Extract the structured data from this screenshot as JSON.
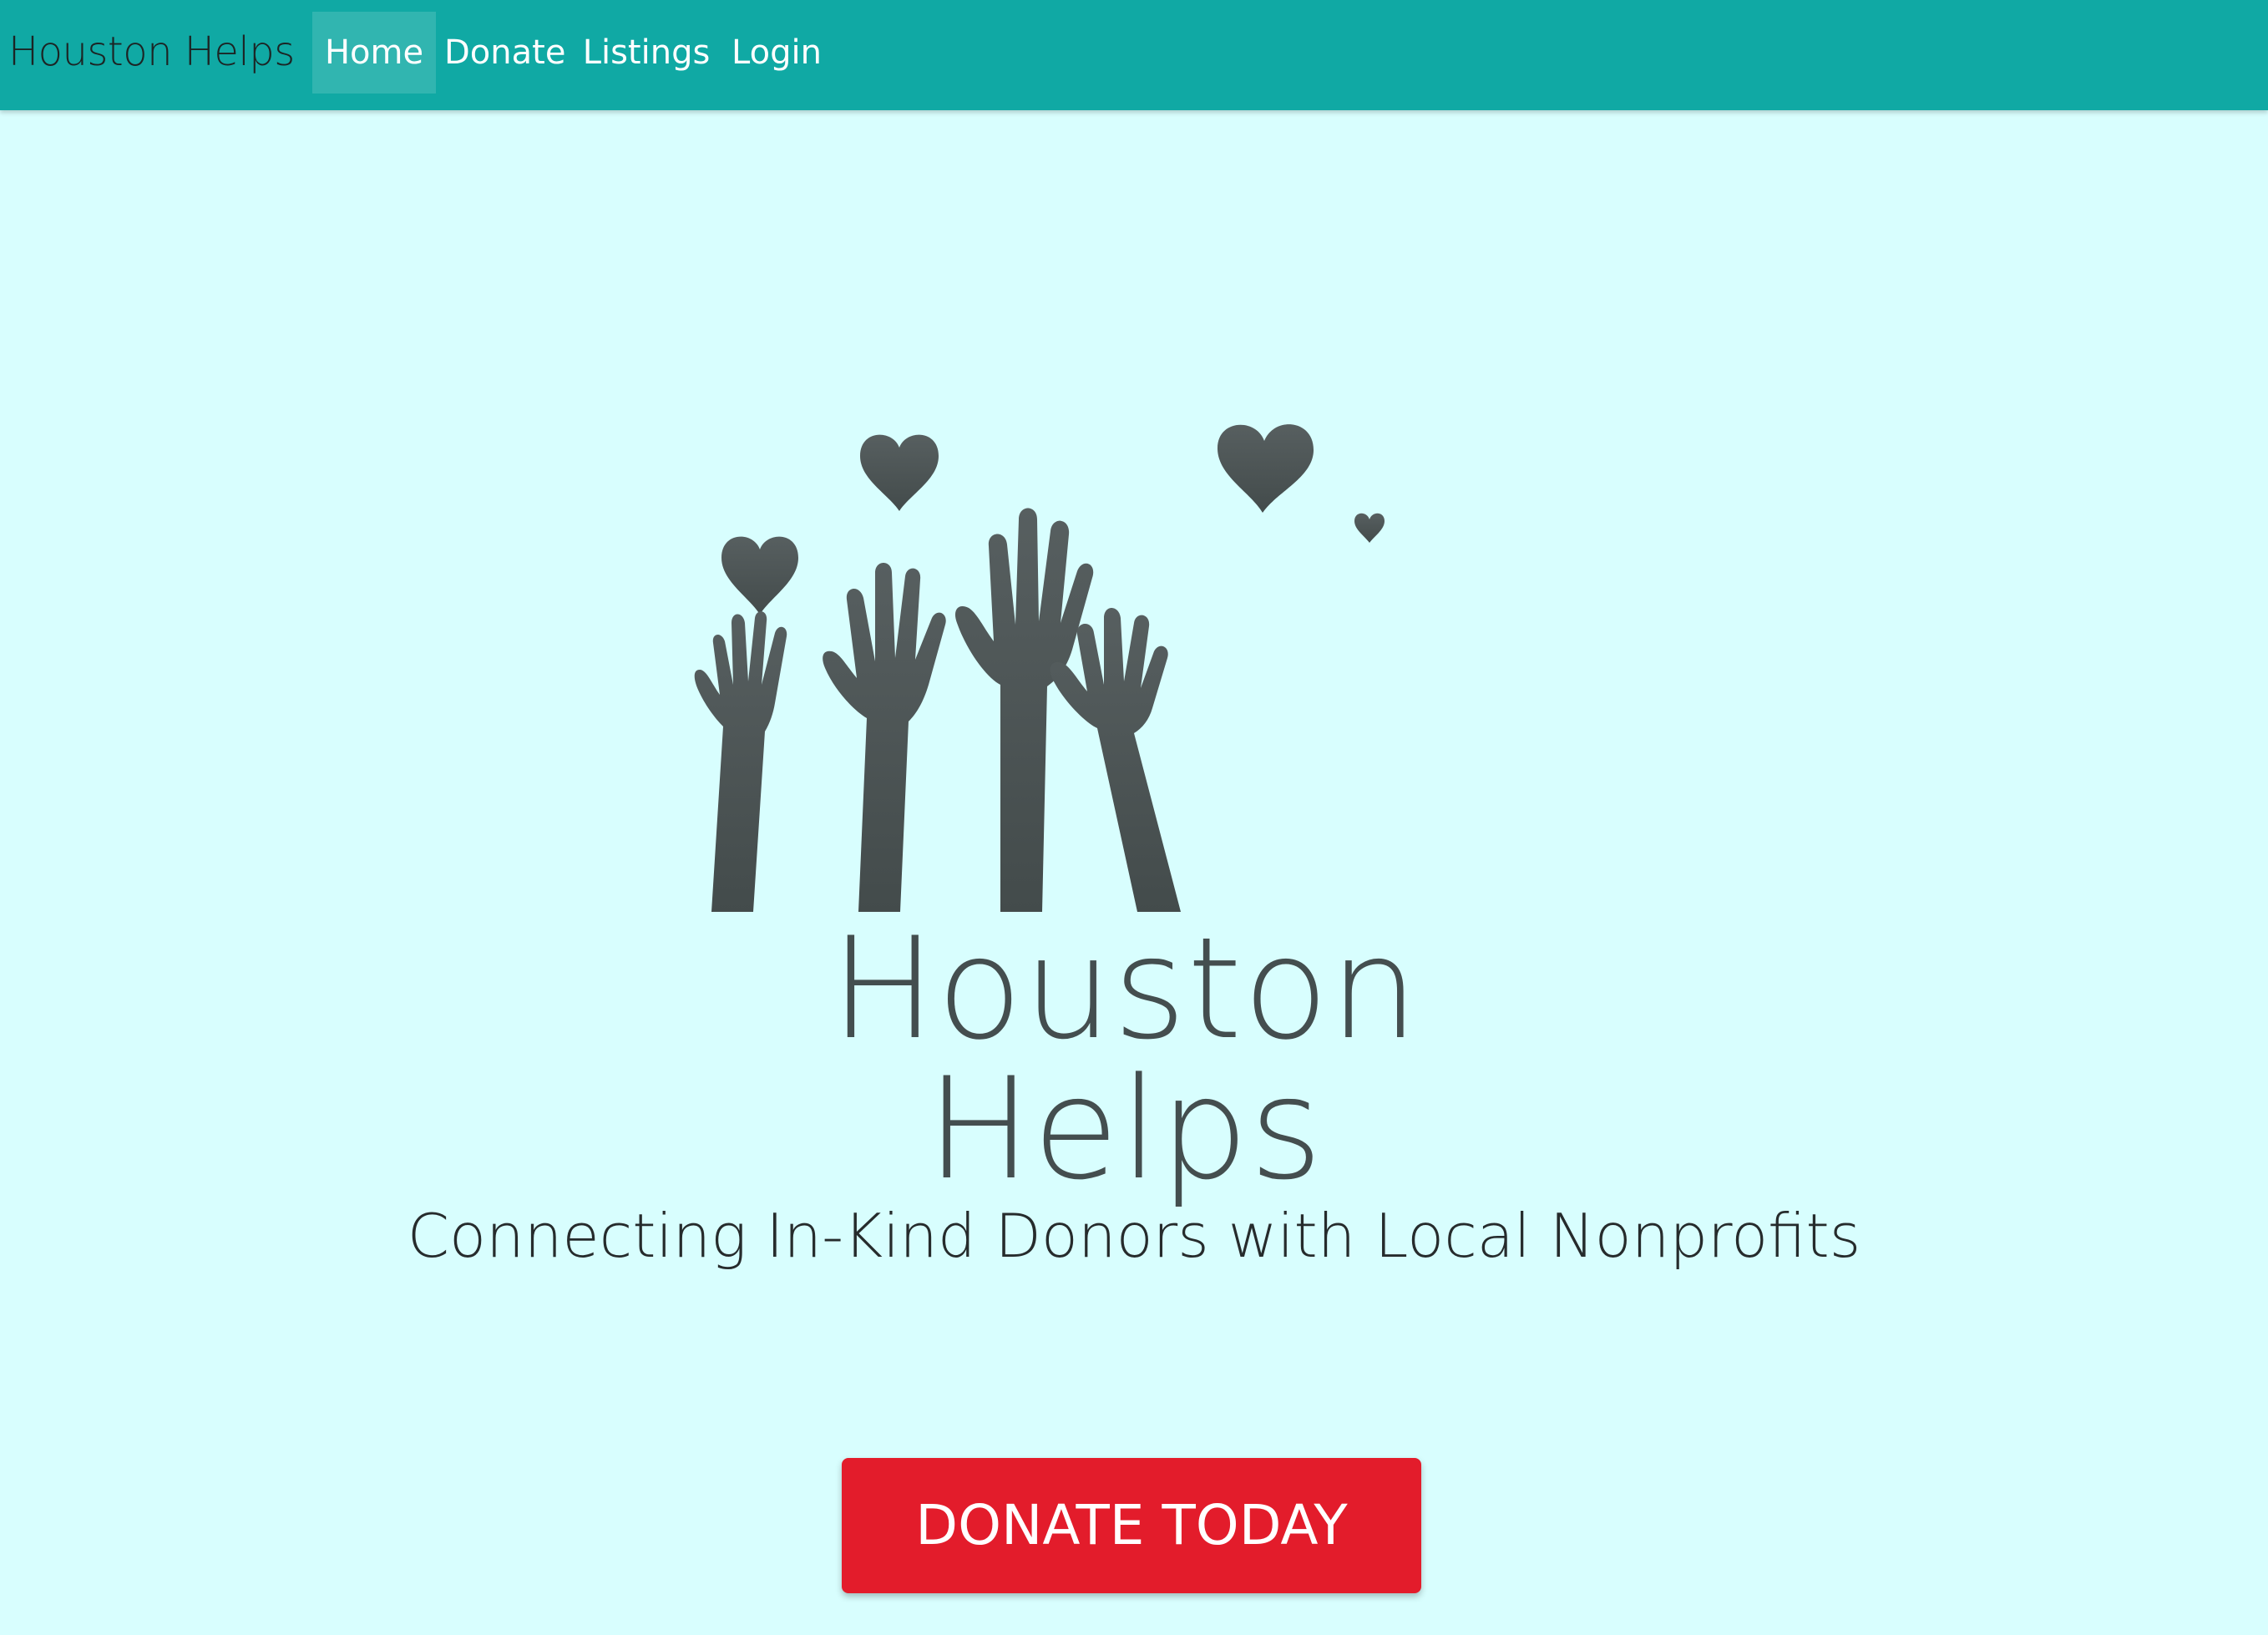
{
  "navbar": {
    "brand": "Houston Helps",
    "items": [
      {
        "label": "Home",
        "active": true
      },
      {
        "label": "Donate",
        "active": false
      },
      {
        "label": "Listings",
        "active": false
      },
      {
        "label": "Login",
        "active": false
      }
    ],
    "background_color": "#10a9a4"
  },
  "hero": {
    "logo_text": "Houston Helps",
    "logo_color": "#444e4f",
    "tagline": "Connecting In-Kind Donors with Local Nonprofits",
    "cta_label": "DONATE TODAY",
    "cta_color": "#e31c2b",
    "background_color": "#d8fefe"
  }
}
